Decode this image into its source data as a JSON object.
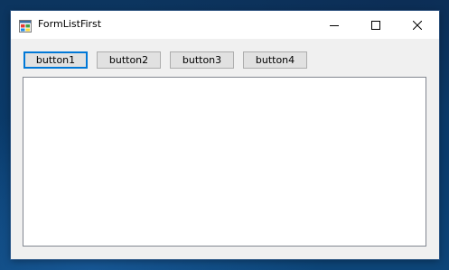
{
  "window": {
    "title": "FormListFirst",
    "icon": "winforms-app-icon",
    "controls": {
      "minimize_icon": "minimize-icon",
      "maximize_icon": "maximize-icon",
      "close_icon": "close-icon"
    }
  },
  "buttons": [
    {
      "label": "button1",
      "focused": true
    },
    {
      "label": "button2",
      "focused": false
    },
    {
      "label": "button3",
      "focused": false
    },
    {
      "label": "button4",
      "focused": false
    }
  ],
  "listbox": {
    "items": []
  },
  "colors": {
    "desktop_background": "#0b3a6a",
    "window_background": "#f0f0f0",
    "titlebar_background": "#ffffff",
    "button_face": "#e1e1e1",
    "button_border": "#adadad",
    "focus_accent": "#0078d7",
    "listbox_border": "#828790"
  }
}
